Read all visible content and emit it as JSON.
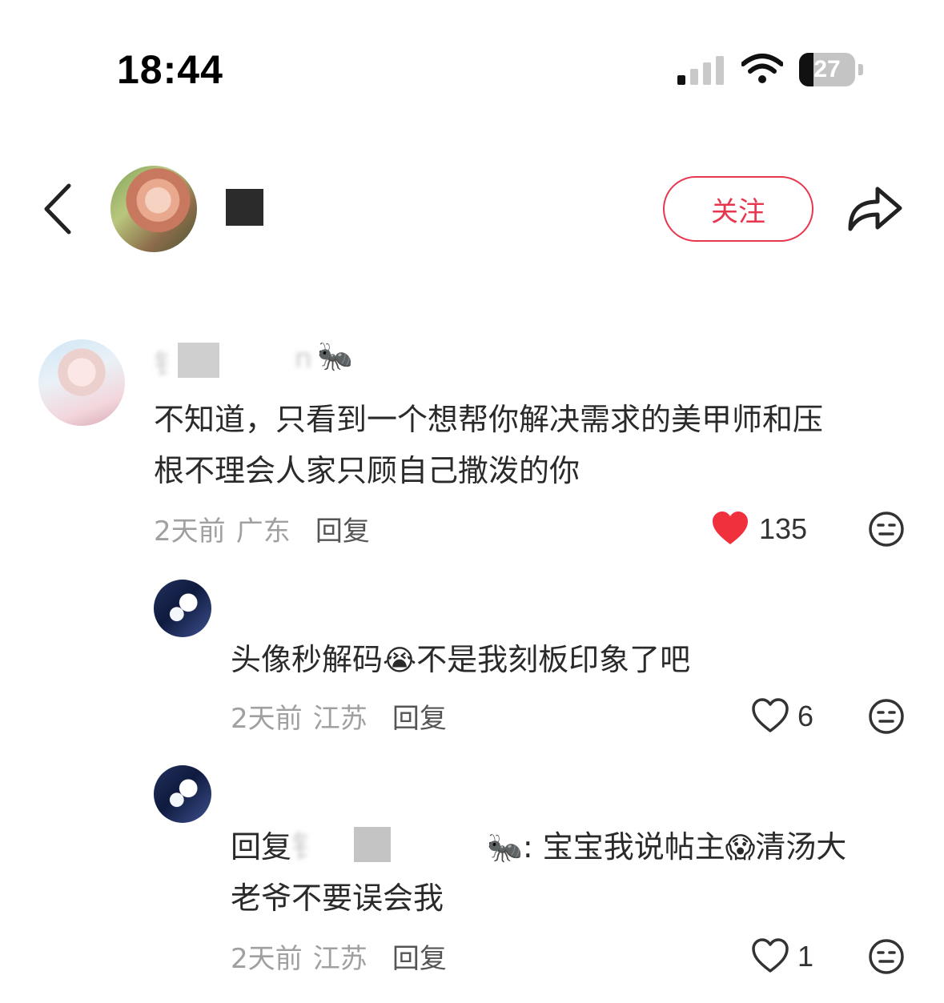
{
  "status_bar": {
    "time": "18:44",
    "battery": "27"
  },
  "header": {
    "username": "",
    "follow_label": "关注"
  },
  "comments": [
    {
      "name_fragment_1": "钅",
      "name_fragment_2": "n",
      "name_emoji": "🐜",
      "text_line1": "不知道，只看到一个想帮你解决需求的美甲师和压",
      "text_line2": "根不理会人家只顾自己撒泼的你",
      "time": "2天前",
      "location": "广东",
      "reply_label": "回复",
      "likes": "135",
      "liked": true
    },
    {
      "text_part1": "头像秒解码",
      "emoji": "😭",
      "text_part2": "不是我刻板印象了吧",
      "time": "2天前",
      "location": "江苏",
      "reply_label": "回复",
      "likes": "6",
      "liked": false
    },
    {
      "reply_prefix": "回复",
      "reply_target_fragment": "钅",
      "target_emoji": "🐜",
      "text_part1": ": 宝宝我说帖主",
      "emoji": "😱",
      "text_part2": "清汤大",
      "text_line2": "老爷不要误会我",
      "time": "2天前",
      "location": "江苏",
      "reply_label": "回复",
      "likes": "1",
      "liked": false
    }
  ],
  "colors": {
    "accent": "#e8364f",
    "like_red": "#f0313d"
  }
}
